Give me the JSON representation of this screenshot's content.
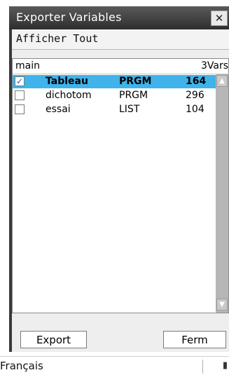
{
  "dialog": {
    "title": "Exporter Variables",
    "close_glyph": "✕"
  },
  "menu": {
    "show_all": "Afficher Tout"
  },
  "list": {
    "folder_name": "main",
    "folder_count": "3Vars",
    "rows": [
      {
        "checked": true,
        "check_glyph": "✓",
        "name": "Tableau",
        "type": "PRGM",
        "size": "164"
      },
      {
        "checked": false,
        "check_glyph": "",
        "name": "dichotom",
        "type": "PRGM",
        "size": "296"
      },
      {
        "checked": false,
        "check_glyph": "",
        "name": "essai",
        "type": "LIST",
        "size": "104"
      }
    ]
  },
  "scrollbar": {
    "up_glyph": "▲",
    "down_glyph": "▼"
  },
  "buttons": {
    "export": "Export",
    "ferm": "Ferm"
  },
  "status_bar": {
    "language": "Français",
    "battery_glyph": "▮"
  },
  "colors": {
    "selection": "#3fb3ea",
    "title_bar": "#3a3a3a"
  }
}
